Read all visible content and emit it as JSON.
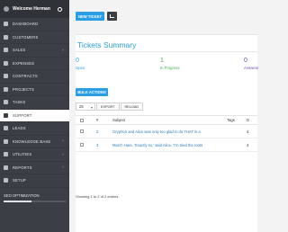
{
  "sidebar": {
    "welcome": "Welcome Herman",
    "items": [
      {
        "label": "DASHBOARD",
        "icon": "dashboard-icon",
        "chevron": false
      },
      {
        "label": "CUSTOMERS",
        "icon": "customers-icon",
        "chevron": false
      },
      {
        "label": "SALES",
        "icon": "sales-icon",
        "chevron": true
      },
      {
        "label": "EXPENSES",
        "icon": "expenses-icon",
        "chevron": false
      },
      {
        "label": "CONTRACTS",
        "icon": "contracts-icon",
        "chevron": false
      },
      {
        "label": "PROJECTS",
        "icon": "projects-icon",
        "chevron": false
      },
      {
        "label": "TASKS",
        "icon": "tasks-icon",
        "chevron": false
      },
      {
        "label": "SUPPORT",
        "icon": "support-icon",
        "chevron": false,
        "active": true
      },
      {
        "label": "LEADS",
        "icon": "leads-icon",
        "chevron": false
      },
      {
        "label": "KNOWLEDGE BASE",
        "icon": "knowledge-base-icon",
        "chevron": true
      },
      {
        "label": "UTILITIES",
        "icon": "utilities-icon",
        "chevron": true
      },
      {
        "label": "REPORTS",
        "icon": "reports-icon",
        "chevron": true
      },
      {
        "label": "SETUP",
        "icon": "setup-icon",
        "chevron": false
      }
    ],
    "seo_label": "SEO OPTIMIZATION"
  },
  "toolbar": {
    "new_ticket": "NEW TICKET"
  },
  "summary": {
    "title": "Tickets Summary",
    "stats": [
      {
        "value": "0",
        "label": "Open"
      },
      {
        "value": "1",
        "label": "In Progress"
      },
      {
        "value": "0",
        "label": "Answere"
      }
    ]
  },
  "bulk_actions": "BULK ACTIONS",
  "controls": {
    "page_size": "25",
    "export": "EXPORT",
    "reload": "RELOAD"
  },
  "table": {
    "headers": [
      "#",
      "Subject",
      "Tags",
      "D"
    ],
    "rows": [
      {
        "id": "2",
        "subject": "Gryphon and Alice was only too glad to do THAT in a",
        "tags": "",
        "d": "4"
      },
      {
        "id": "3",
        "subject": "March Hare. 'Exactly so,' said Alice. 'I'm tried the roots",
        "tags": "",
        "d": "4"
      }
    ],
    "footer": "Showing 1 to 2 of 2 entries"
  },
  "colors": {
    "accent": "#2a9ee5",
    "sidebar": "#3b3f45",
    "open": "#2aa0d7",
    "in_progress": "#4cb050",
    "answered": "#6a49a8"
  }
}
